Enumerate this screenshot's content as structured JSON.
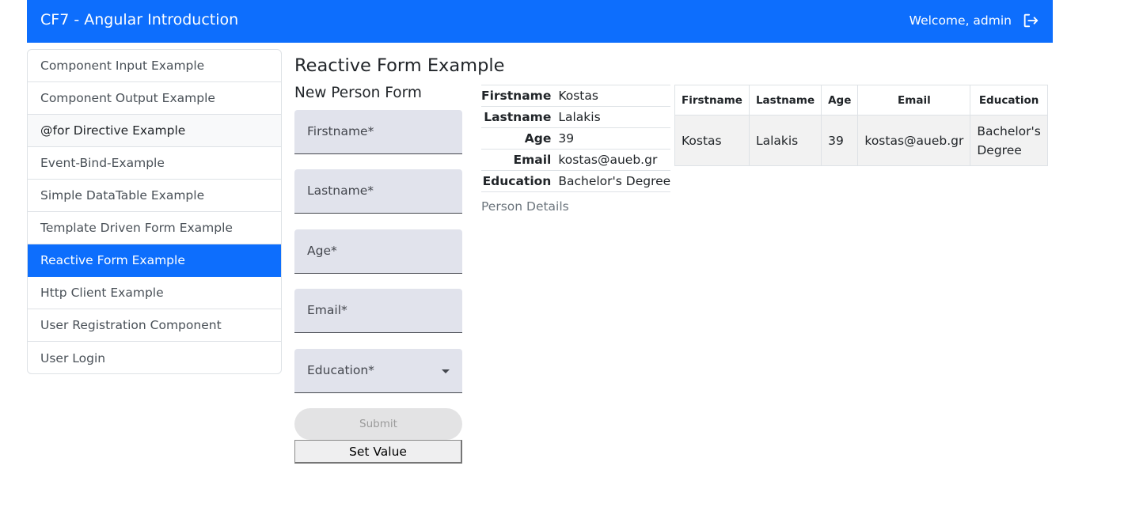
{
  "header": {
    "brand": "CF7 - Angular Introduction",
    "welcome": "Welcome, admin"
  },
  "sidebar": {
    "items": [
      {
        "label": "Component Input Example"
      },
      {
        "label": "Component Output Example"
      },
      {
        "label": "@for Directive Example"
      },
      {
        "label": "Event-Bind-Example"
      },
      {
        "label": "Simple DataTable Example"
      },
      {
        "label": "Template Driven Form Example"
      },
      {
        "label": "Reactive Form Example"
      },
      {
        "label": "Http Client Example"
      },
      {
        "label": "User Registration Component"
      },
      {
        "label": "User Login"
      }
    ],
    "active_item": "Reactive Form Example",
    "hovered_item": "@for Directive Example"
  },
  "main": {
    "title": "Reactive Form Example",
    "form": {
      "title": "New Person Form",
      "fields": {
        "firstname": {
          "label": "Firstname*",
          "value": ""
        },
        "lastname": {
          "label": "Lastname*",
          "value": ""
        },
        "age": {
          "label": "Age*",
          "value": ""
        },
        "email": {
          "label": "Email*",
          "value": ""
        },
        "education": {
          "label": "Education*",
          "value": ""
        }
      },
      "submit_label": "Submit",
      "set_value_label": "Set Value"
    },
    "person_details": {
      "rows": [
        {
          "key": "Firstname",
          "value": "Kostas"
        },
        {
          "key": "Lastname",
          "value": "Lalakis"
        },
        {
          "key": "Age",
          "value": "39"
        },
        {
          "key": "Email",
          "value": "kostas@aueb.gr"
        },
        {
          "key": "Education",
          "value": "Bachelor's Degree"
        }
      ],
      "caption": "Person Details"
    },
    "people_table": {
      "headers": [
        "Firstname",
        "Lastname",
        "Age",
        "Email",
        "Education"
      ],
      "rows": [
        [
          "Kostas",
          "Lalakis",
          "39",
          "kostas@aueb.gr",
          "Bachelor's Degree"
        ]
      ]
    }
  },
  "colors": {
    "primary": "#0d6efd",
    "field_bg": "#e1e3ec",
    "row_bg": "#f2f2f2"
  },
  "icons": {
    "logout": "logout-icon",
    "dropdown": "caret-down-icon"
  }
}
